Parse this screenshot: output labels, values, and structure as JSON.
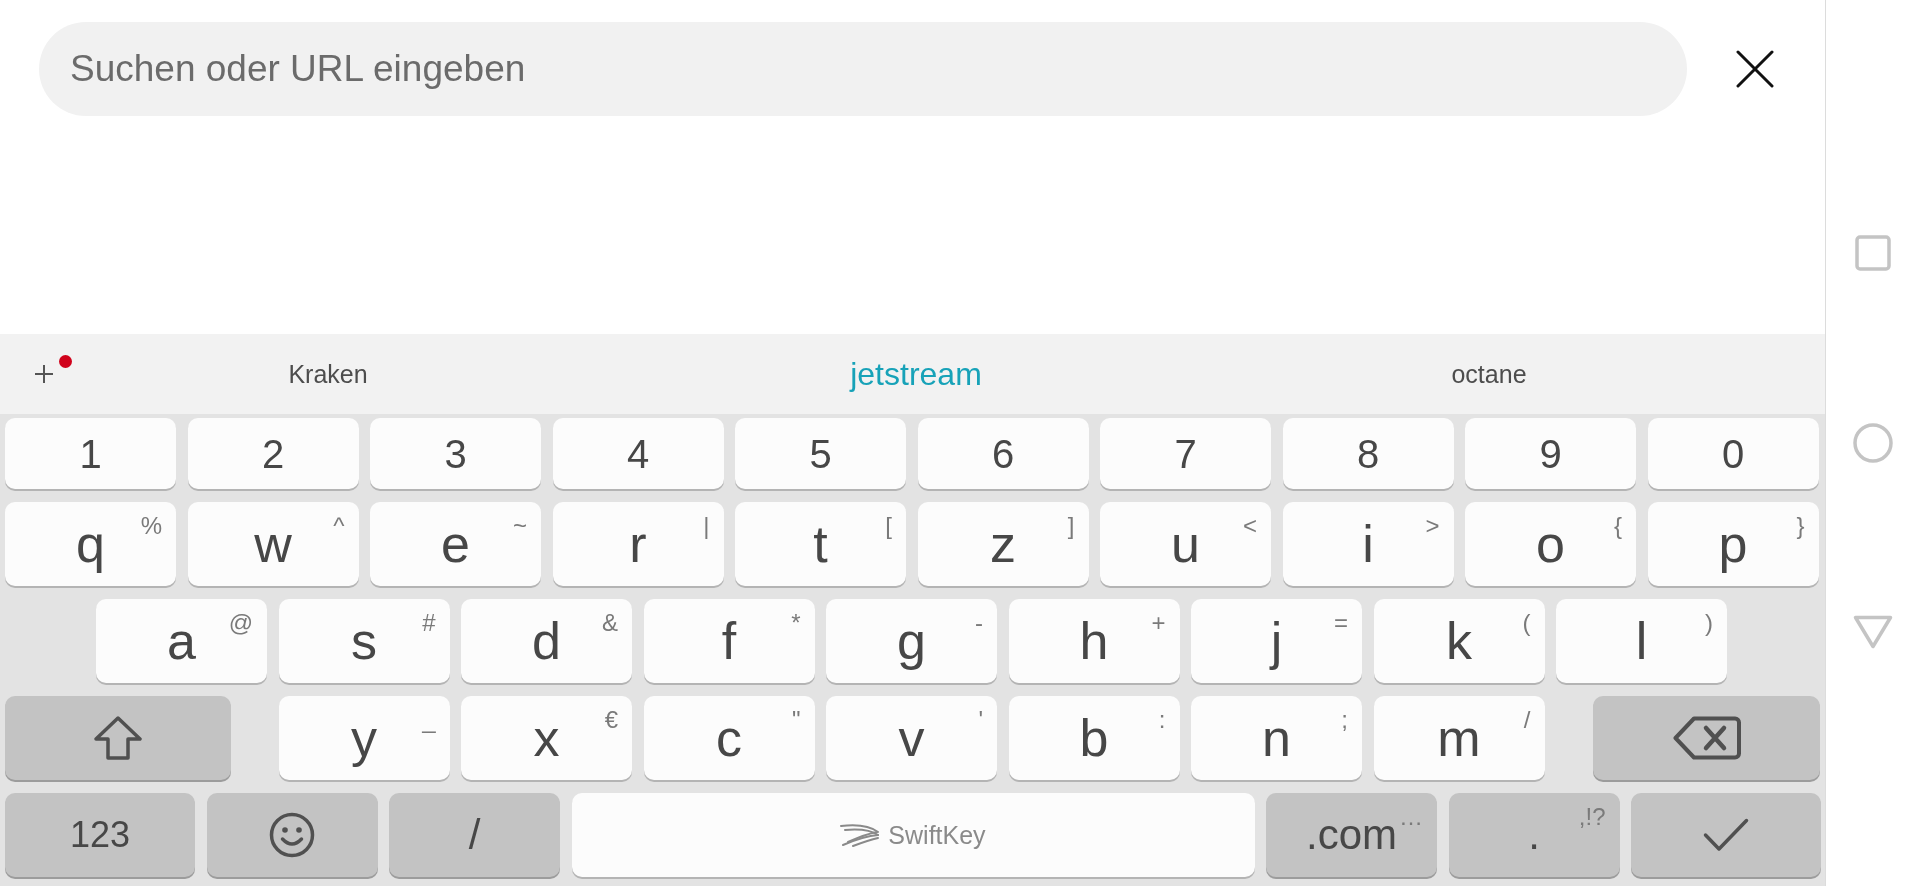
{
  "search": {
    "placeholder": "Suchen oder URL eingeben"
  },
  "suggestion_bar": {
    "add_button": {
      "badge": true
    },
    "suggestions": [
      {
        "text": "Kraken",
        "selected": false
      },
      {
        "text": "jetstream",
        "selected": true
      },
      {
        "text": "octane",
        "selected": false
      }
    ]
  },
  "keyboard": {
    "rows": [
      {
        "keys": [
          {
            "kind": "digit",
            "label": "1"
          },
          {
            "kind": "digit",
            "label": "2"
          },
          {
            "kind": "digit",
            "label": "3"
          },
          {
            "kind": "digit",
            "label": "4"
          },
          {
            "kind": "digit",
            "label": "5"
          },
          {
            "kind": "digit",
            "label": "6"
          },
          {
            "kind": "digit",
            "label": "7"
          },
          {
            "kind": "digit",
            "label": "8"
          },
          {
            "kind": "digit",
            "label": "9"
          },
          {
            "kind": "digit",
            "label": "0"
          }
        ]
      },
      {
        "keys": [
          {
            "kind": "letter",
            "label": "q",
            "alt": "%"
          },
          {
            "kind": "letter",
            "label": "w",
            "alt": "^"
          },
          {
            "kind": "letter",
            "label": "e",
            "alt": "~"
          },
          {
            "kind": "letter",
            "label": "r",
            "alt": "|"
          },
          {
            "kind": "letter",
            "label": "t",
            "alt": "["
          },
          {
            "kind": "letter",
            "label": "z",
            "alt": "]"
          },
          {
            "kind": "letter",
            "label": "u",
            "alt": "<"
          },
          {
            "kind": "letter",
            "label": "i",
            "alt": ">"
          },
          {
            "kind": "letter",
            "label": "o",
            "alt": "{"
          },
          {
            "kind": "letter",
            "label": "p",
            "alt": "}"
          }
        ]
      },
      {
        "keys": [
          {
            "kind": "letter",
            "label": "a",
            "alt": "@"
          },
          {
            "kind": "letter",
            "label": "s",
            "alt": "#"
          },
          {
            "kind": "letter",
            "label": "d",
            "alt": "&"
          },
          {
            "kind": "letter",
            "label": "f",
            "alt": "*"
          },
          {
            "kind": "letter",
            "label": "g",
            "alt": "-"
          },
          {
            "kind": "letter",
            "label": "h",
            "alt": "+"
          },
          {
            "kind": "letter",
            "label": "j",
            "alt": "="
          },
          {
            "kind": "letter",
            "label": "k",
            "alt": "("
          },
          {
            "kind": "letter",
            "label": "l",
            "alt": ")"
          }
        ]
      },
      {
        "keys": [
          {
            "kind": "shift"
          },
          {
            "kind": "letter",
            "label": "y",
            "alt": "_"
          },
          {
            "kind": "letter",
            "label": "x",
            "alt": "€"
          },
          {
            "kind": "letter",
            "label": "c",
            "alt": "\""
          },
          {
            "kind": "letter",
            "label": "v",
            "alt": "'"
          },
          {
            "kind": "letter",
            "label": "b",
            "alt": ":"
          },
          {
            "kind": "letter",
            "label": "n",
            "alt": ";"
          },
          {
            "kind": "letter",
            "label": "m",
            "alt": "/"
          },
          {
            "kind": "backspace"
          }
        ]
      },
      {
        "keys": [
          {
            "kind": "mode",
            "label": "123"
          },
          {
            "kind": "emoji"
          },
          {
            "kind": "function",
            "label": "/"
          },
          {
            "kind": "space",
            "label": "SwiftKey"
          },
          {
            "kind": "function",
            "label": ".com",
            "alt": "…"
          },
          {
            "kind": "function",
            "label": ".",
            "alt": ",!?"
          },
          {
            "kind": "enter"
          }
        ]
      }
    ]
  }
}
